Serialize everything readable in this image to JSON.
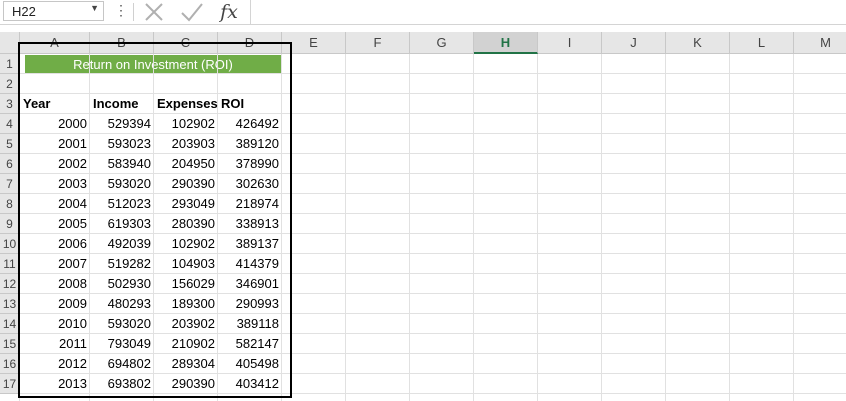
{
  "name_box": {
    "value": "H22"
  },
  "formula_bar": {
    "fx_label": "fx",
    "formula": ""
  },
  "columns": [
    "A",
    "B",
    "C",
    "D",
    "E",
    "F",
    "G",
    "H",
    "I",
    "J",
    "K",
    "L",
    "M"
  ],
  "active_column": "H",
  "rows": [
    "1",
    "2",
    "3",
    "4",
    "5",
    "6",
    "7",
    "8",
    "9",
    "10",
    "11",
    "12",
    "13",
    "14",
    "15",
    "16",
    "17"
  ],
  "sheet": {
    "title": "Return on Investment (ROI)",
    "title_color": "#70ad47",
    "headers": [
      "Year",
      "Income",
      "Expenses",
      "ROI"
    ],
    "data": [
      [
        "2000",
        "529394",
        "102902",
        "426492"
      ],
      [
        "2001",
        "593023",
        "203903",
        "389120"
      ],
      [
        "2002",
        "583940",
        "204950",
        "378990"
      ],
      [
        "2003",
        "593020",
        "290390",
        "302630"
      ],
      [
        "2004",
        "512023",
        "293049",
        "218974"
      ],
      [
        "2005",
        "619303",
        "280390",
        "338913"
      ],
      [
        "2006",
        "492039",
        "102902",
        "389137"
      ],
      [
        "2007",
        "519282",
        "104903",
        "414379"
      ],
      [
        "2008",
        "502930",
        "156029",
        "346901"
      ],
      [
        "2009",
        "480293",
        "189300",
        "290993"
      ],
      [
        "2010",
        "593020",
        "203902",
        "389118"
      ],
      [
        "2011",
        "793049",
        "210902",
        "582147"
      ],
      [
        "2012",
        "694802",
        "289304",
        "405498"
      ],
      [
        "2013",
        "693802",
        "290390",
        "403412"
      ]
    ]
  }
}
